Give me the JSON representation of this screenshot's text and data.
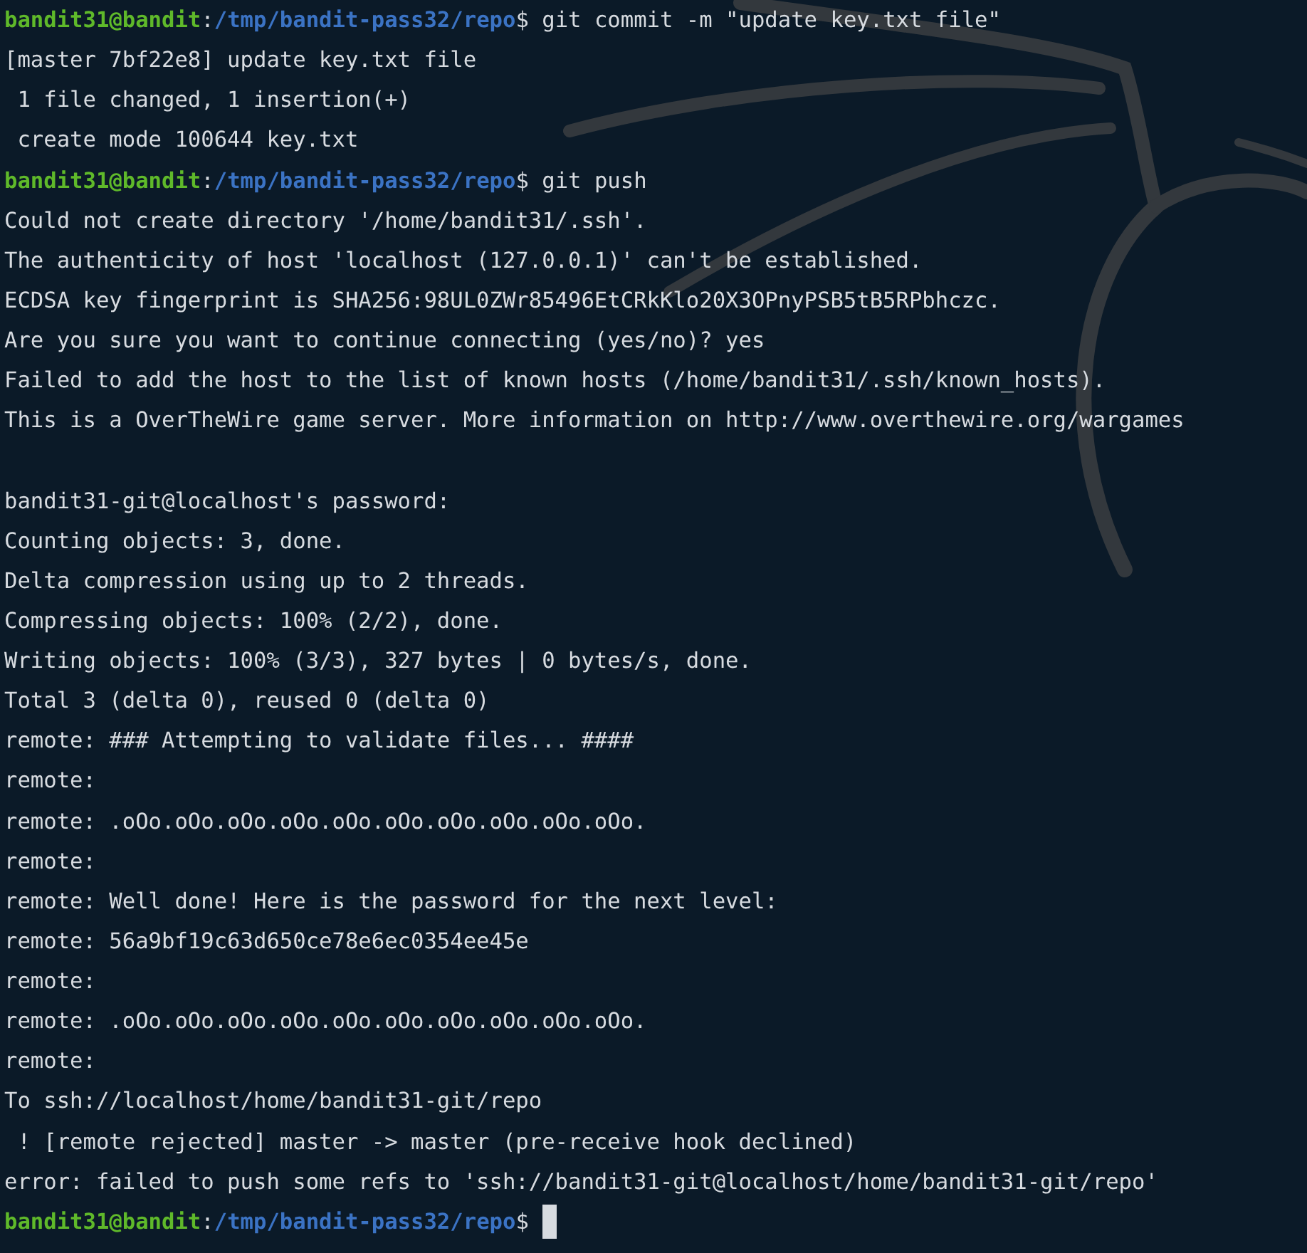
{
  "terminal": {
    "lines": [
      {
        "kind": "prompt",
        "user": "bandit31@bandit",
        "sep": ":",
        "path": "/tmp/bandit-pass32/repo",
        "command": "$ git commit -m \"update key.txt file\"",
        "cursor": false
      },
      {
        "kind": "output",
        "text": "[master 7bf22e8] update key.txt file"
      },
      {
        "kind": "output",
        "text": " 1 file changed, 1 insertion(+)"
      },
      {
        "kind": "output",
        "text": " create mode 100644 key.txt"
      },
      {
        "kind": "prompt",
        "user": "bandit31@bandit",
        "sep": ":",
        "path": "/tmp/bandit-pass32/repo",
        "command": "$ git push",
        "cursor": false
      },
      {
        "kind": "output",
        "text": "Could not create directory '/home/bandit31/.ssh'."
      },
      {
        "kind": "output",
        "text": "The authenticity of host 'localhost (127.0.0.1)' can't be established."
      },
      {
        "kind": "output",
        "text": "ECDSA key fingerprint is SHA256:98UL0ZWr85496EtCRkKlo20X3OPnyPSB5tB5RPbhczc."
      },
      {
        "kind": "output",
        "text": "Are you sure you want to continue connecting (yes/no)? yes"
      },
      {
        "kind": "output",
        "text": "Failed to add the host to the list of known hosts (/home/bandit31/.ssh/known_hosts)."
      },
      {
        "kind": "output",
        "text": "This is a OverTheWire game server. More information on http://www.overthewire.org/wargames"
      },
      {
        "kind": "blank"
      },
      {
        "kind": "output",
        "text": "bandit31-git@localhost's password:"
      },
      {
        "kind": "output",
        "text": "Counting objects: 3, done."
      },
      {
        "kind": "output",
        "text": "Delta compression using up to 2 threads."
      },
      {
        "kind": "output",
        "text": "Compressing objects: 100% (2/2), done."
      },
      {
        "kind": "output",
        "text": "Writing objects: 100% (3/3), 327 bytes | 0 bytes/s, done."
      },
      {
        "kind": "output",
        "text": "Total 3 (delta 0), reused 0 (delta 0)"
      },
      {
        "kind": "output",
        "text": "remote: ### Attempting to validate files... ####"
      },
      {
        "kind": "output",
        "text": "remote:"
      },
      {
        "kind": "output",
        "text": "remote: .oOo.oOo.oOo.oOo.oOo.oOo.oOo.oOo.oOo.oOo."
      },
      {
        "kind": "output",
        "text": "remote:"
      },
      {
        "kind": "output",
        "text": "remote: Well done! Here is the password for the next level:"
      },
      {
        "kind": "output",
        "text": "remote: 56a9bf19c63d650ce78e6ec0354ee45e"
      },
      {
        "kind": "output",
        "text": "remote:"
      },
      {
        "kind": "output",
        "text": "remote: .oOo.oOo.oOo.oOo.oOo.oOo.oOo.oOo.oOo.oOo."
      },
      {
        "kind": "output",
        "text": "remote:"
      },
      {
        "kind": "output",
        "text": "To ssh://localhost/home/bandit31-git/repo"
      },
      {
        "kind": "output",
        "text": " ! [remote rejected] master -> master (pre-receive hook declined)"
      },
      {
        "kind": "output",
        "text": "error: failed to push some refs to 'ssh://bandit31-git@localhost/home/bandit31-git/repo'"
      },
      {
        "kind": "prompt",
        "user": "bandit31@bandit",
        "sep": ":",
        "path": "/tmp/bandit-pass32/repo",
        "command": "$ ",
        "cursor": true
      }
    ]
  }
}
